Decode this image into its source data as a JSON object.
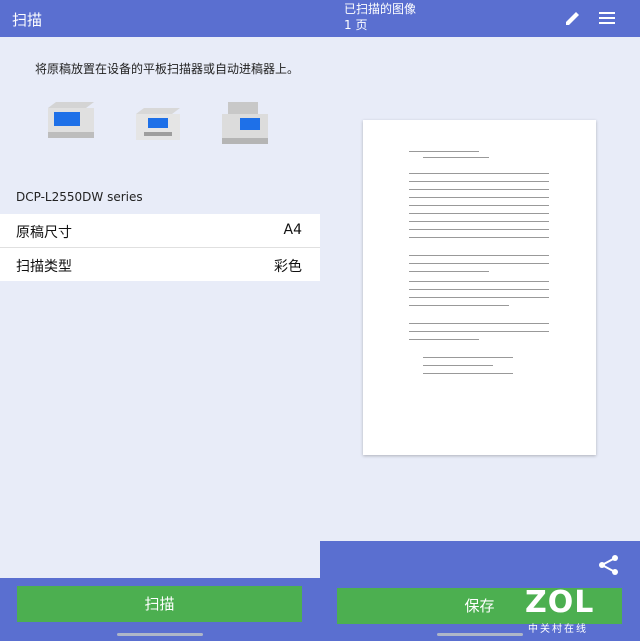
{
  "left": {
    "title": "扫描",
    "instruction": "将原稿放置在设备的平板扫描器或自动进稿器上。",
    "device": "DCP-L2550DW series",
    "settings": [
      {
        "label": "原稿尺寸",
        "value": "A4"
      },
      {
        "label": "扫描类型",
        "value": "彩色"
      }
    ],
    "scan_button": "扫描"
  },
  "right": {
    "title": "已扫描的图像",
    "page": "1 页",
    "save_button": "保存",
    "watermark": "ZOL",
    "watermark_sub": "中关村在线"
  },
  "colors": {
    "bar": "#5a6fd0",
    "button": "#4caf50",
    "bg": "#e8ecf8"
  }
}
